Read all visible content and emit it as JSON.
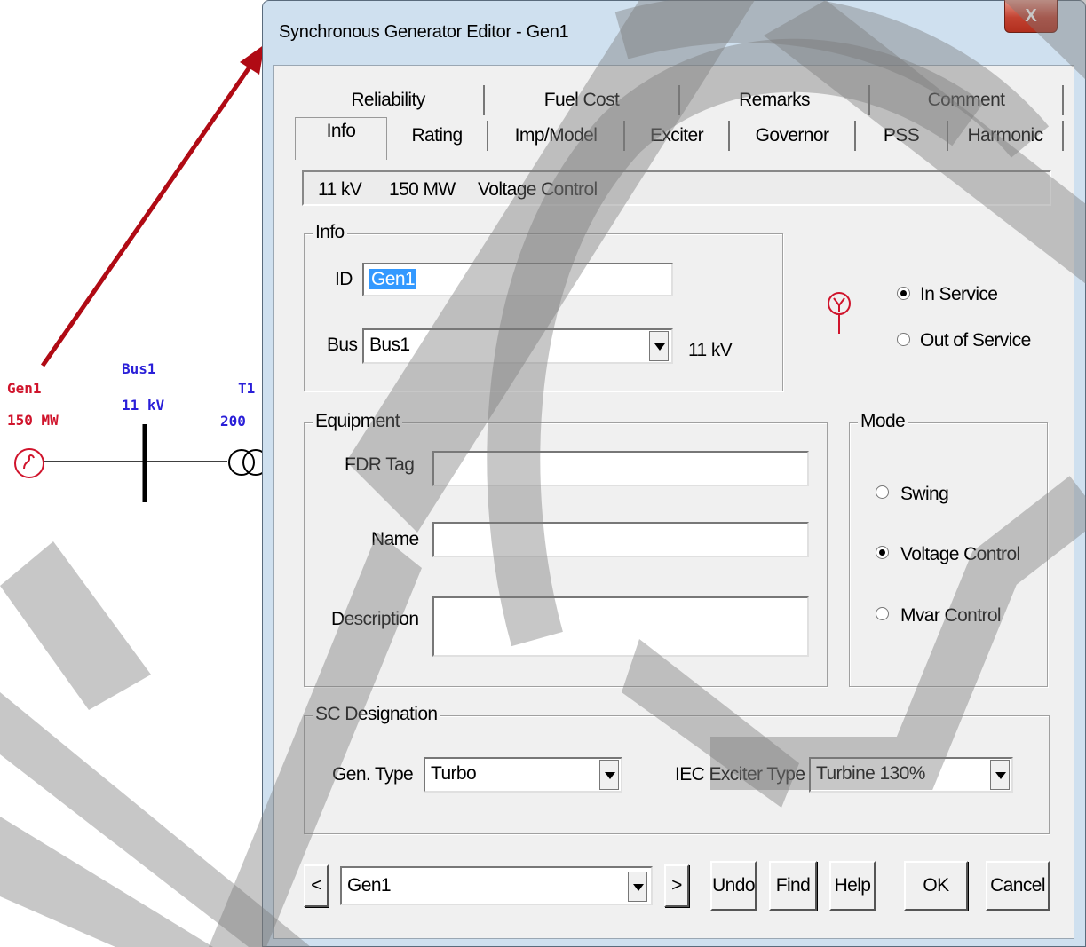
{
  "diagram": {
    "gen_label": "Gen1",
    "gen_rating": "150 MW",
    "bus_label": "Bus1",
    "bus_voltage": "11 kV",
    "transformer_label": "T1",
    "transformer_rating": "200"
  },
  "window": {
    "title": "Synchronous Generator Editor - Gen1",
    "close_label": "X"
  },
  "tabs": {
    "row1": [
      "Reliability",
      "Fuel Cost",
      "Remarks",
      "Comment"
    ],
    "row2": [
      "Info",
      "Rating",
      "Imp/Model",
      "Exciter",
      "Governor",
      "PSS",
      "Harmonic"
    ],
    "active": "Info"
  },
  "status": {
    "voltage": "11 kV",
    "power": "150 MW",
    "mode": "Voltage Control"
  },
  "info_group": {
    "title": "Info",
    "id_label": "ID",
    "id_value": "Gen1",
    "bus_label": "Bus",
    "bus_value": "Bus1",
    "bus_voltage": "11 kV"
  },
  "service": {
    "in_service": "In Service",
    "out_of_service": "Out of Service",
    "selected": "In Service"
  },
  "equipment_group": {
    "title": "Equipment",
    "fdr_tag_label": "FDR Tag",
    "fdr_tag_value": "",
    "name_label": "Name",
    "name_value": "",
    "description_label": "Description",
    "description_value": ""
  },
  "mode_group": {
    "title": "Mode",
    "options": [
      "Swing",
      "Voltage Control",
      "Mvar Control"
    ],
    "selected": "Voltage Control"
  },
  "sc_group": {
    "title": "SC Designation",
    "gen_type_label": "Gen. Type",
    "gen_type_value": "Turbo",
    "iec_label": "IEC Exciter Type",
    "iec_value": "Turbine 130%"
  },
  "footer": {
    "prev_label": "<",
    "next_label": ">",
    "element_value": "Gen1",
    "undo_label": "Undo",
    "find_label": "Find",
    "help_label": "Help",
    "ok_label": "OK",
    "cancel_label": "Cancel"
  },
  "colors": {
    "diagram_red": "#d0142c",
    "diagram_blue": "#2a1fd8",
    "arrow": "#b00a14",
    "watermark": "#7a7a7a"
  }
}
